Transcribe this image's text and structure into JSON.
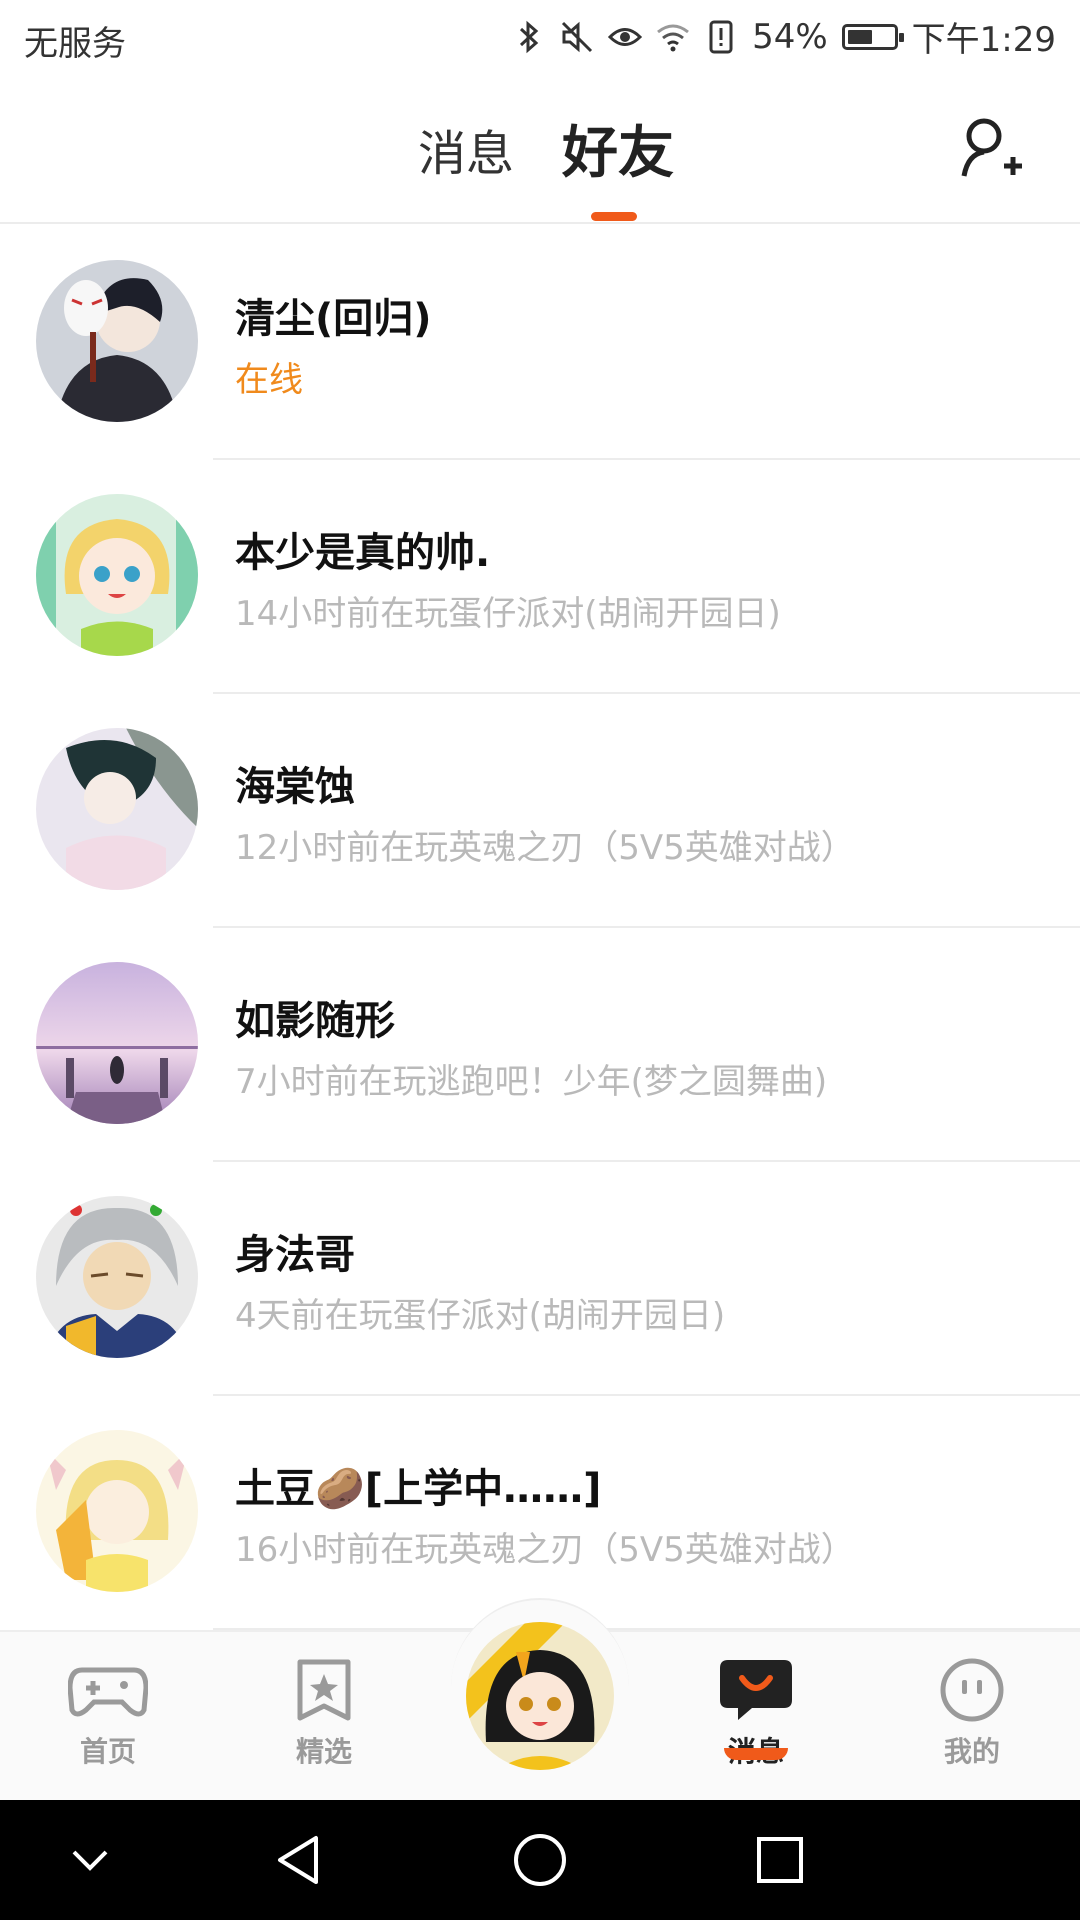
{
  "status_bar": {
    "carrier": "无服务",
    "battery_percent": "54%",
    "battery_level": 0.54,
    "time": "下午1:29",
    "icons": [
      "bluetooth-icon",
      "mute-icon",
      "eye-icon",
      "wifi-icon",
      "alert-icon",
      "battery-icon"
    ]
  },
  "header": {
    "tabs": [
      {
        "label": "消息",
        "active": false
      },
      {
        "label": "好友",
        "active": true
      }
    ],
    "add_friend_icon": "add-friend-icon"
  },
  "friends": [
    {
      "name": "清尘(回归)",
      "status": "在线",
      "online": true
    },
    {
      "name": "本少是真的帅.",
      "status": "14小时前在玩蛋仔派对(胡闹开园日)",
      "online": false
    },
    {
      "name": "海棠蚀",
      "status": "12小时前在玩英魂之刃（5V5英雄对战）",
      "online": false
    },
    {
      "name": "如影随形",
      "status": "7小时前在玩逃跑吧！少年(梦之圆舞曲)",
      "online": false
    },
    {
      "name": "身法哥",
      "status": "4天前在玩蛋仔派对(胡闹开园日)",
      "online": false
    },
    {
      "name": "土豆🥔[上学中……]",
      "status": "16小时前在玩英魂之刃（5V5英雄对战）",
      "online": false
    }
  ],
  "bottom_nav": {
    "items": [
      {
        "label": "首页",
        "icon": "gamepad-icon"
      },
      {
        "label": "精选",
        "icon": "star-bookmark-icon"
      },
      {
        "label": "",
        "icon": "center-avatar"
      },
      {
        "label": "消息",
        "icon": "chat-bubble-icon",
        "active": true
      },
      {
        "label": "我的",
        "icon": "profile-face-icon"
      }
    ]
  },
  "colors": {
    "accent": "#f05a1a",
    "online": "#f08a1c",
    "muted_text": "#b9b9b9"
  }
}
